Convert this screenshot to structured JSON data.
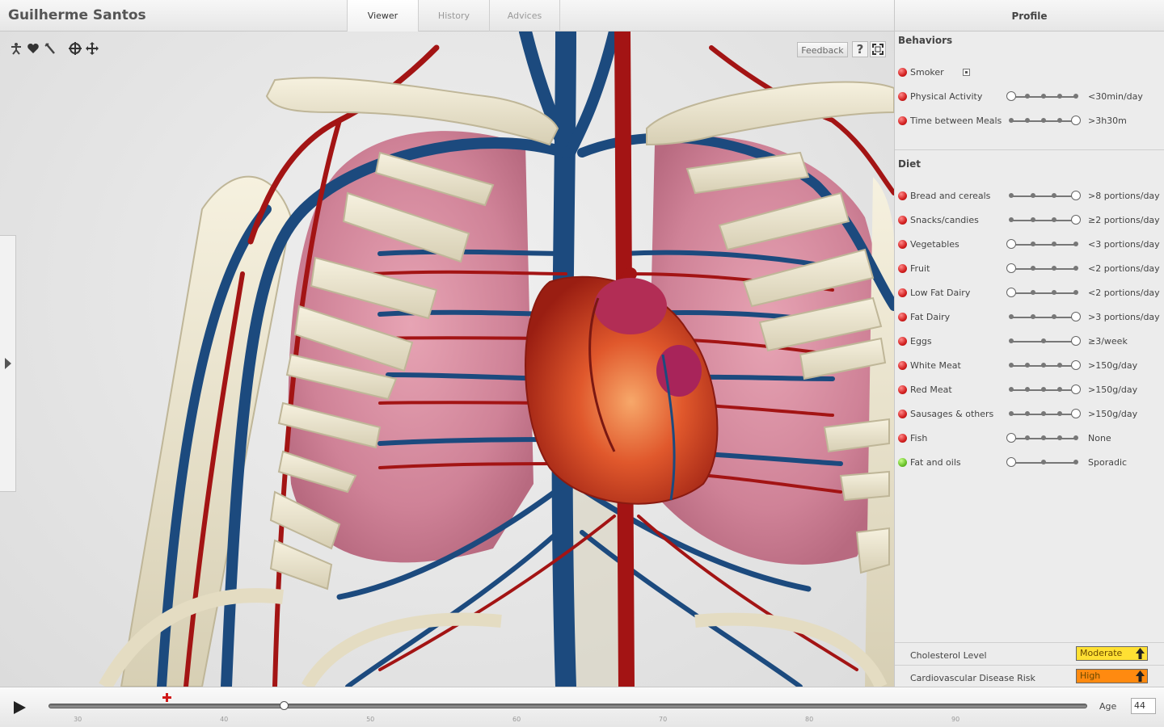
{
  "header": {
    "user_name": "Guilherme Santos",
    "tabs": [
      {
        "label": "Viewer",
        "active": true
      },
      {
        "label": "History",
        "active": false
      },
      {
        "label": "Advices",
        "active": false
      }
    ]
  },
  "viewer": {
    "toolbar_icons": [
      "body-icon",
      "heart-icon",
      "tools-icon",
      "rotate-icon",
      "pan-icon"
    ],
    "feedback_label": "Feedback",
    "help_label": "?"
  },
  "panel": {
    "title": "Profile",
    "behaviors": {
      "title": "Behaviors",
      "smoker": {
        "label": "Smoker",
        "status": "red",
        "checked": true
      },
      "items": [
        {
          "label": "Physical Activity",
          "status": "red",
          "steps": 4,
          "level": 0.0,
          "value": "<30min/day"
        },
        {
          "label": "Time between Meals",
          "status": "red",
          "steps": 4,
          "level": 1.0,
          "value": ">3h30m"
        }
      ]
    },
    "diet": {
      "title": "Diet",
      "items": [
        {
          "label": "Bread and cereals",
          "status": "red",
          "steps": 3,
          "level": 1.0,
          "value": ">8 portions/day"
        },
        {
          "label": "Snacks/candies",
          "status": "red",
          "steps": 3,
          "level": 1.0,
          "value": "≥2 portions/day"
        },
        {
          "label": "Vegetables",
          "status": "red",
          "steps": 3,
          "level": 0.0,
          "value": "<3 portions/day"
        },
        {
          "label": "Fruit",
          "status": "red",
          "steps": 3,
          "level": 0.0,
          "value": "<2 portions/day"
        },
        {
          "label": "Low Fat Dairy",
          "status": "red",
          "steps": 3,
          "level": 0.0,
          "value": "<2 portions/day"
        },
        {
          "label": "Fat Dairy",
          "status": "red",
          "steps": 3,
          "level": 1.0,
          "value": ">3 portions/day"
        },
        {
          "label": "Eggs",
          "status": "red",
          "steps": 2,
          "level": 1.0,
          "value": "≥3/week"
        },
        {
          "label": "White Meat",
          "status": "red",
          "steps": 4,
          "level": 1.0,
          "value": ">150g/day"
        },
        {
          "label": "Red Meat",
          "status": "red",
          "steps": 4,
          "level": 1.0,
          "value": ">150g/day"
        },
        {
          "label": "Sausages & others",
          "status": "red",
          "steps": 4,
          "level": 1.0,
          "value": ">150g/day"
        },
        {
          "label": "Fish",
          "status": "red",
          "steps": 4,
          "level": 0.0,
          "value": "None"
        },
        {
          "label": "Fat and oils",
          "status": "green",
          "steps": 2,
          "level": 0.0,
          "value": "Sporadic"
        }
      ]
    },
    "risks": [
      {
        "label": "Cholesterol Level",
        "value": "Moderate",
        "color": "#ffe033"
      },
      {
        "label": "Cardiovascular Disease Risk",
        "value": "High",
        "color": "#ff8a10"
      }
    ]
  },
  "timeline": {
    "ticks": [
      "30",
      "40",
      "50",
      "60",
      "70",
      "80",
      "90"
    ],
    "age_min": 28,
    "age_max": 99,
    "current_age": 44,
    "event_marker_age": 36,
    "age_label": "Age",
    "age_value": "44"
  },
  "colors": {
    "status_red": "#d32020",
    "status_green": "#6ac22a",
    "artery": "#a31414",
    "vein": "#1c4a7e",
    "bone": "#ede6d0"
  }
}
